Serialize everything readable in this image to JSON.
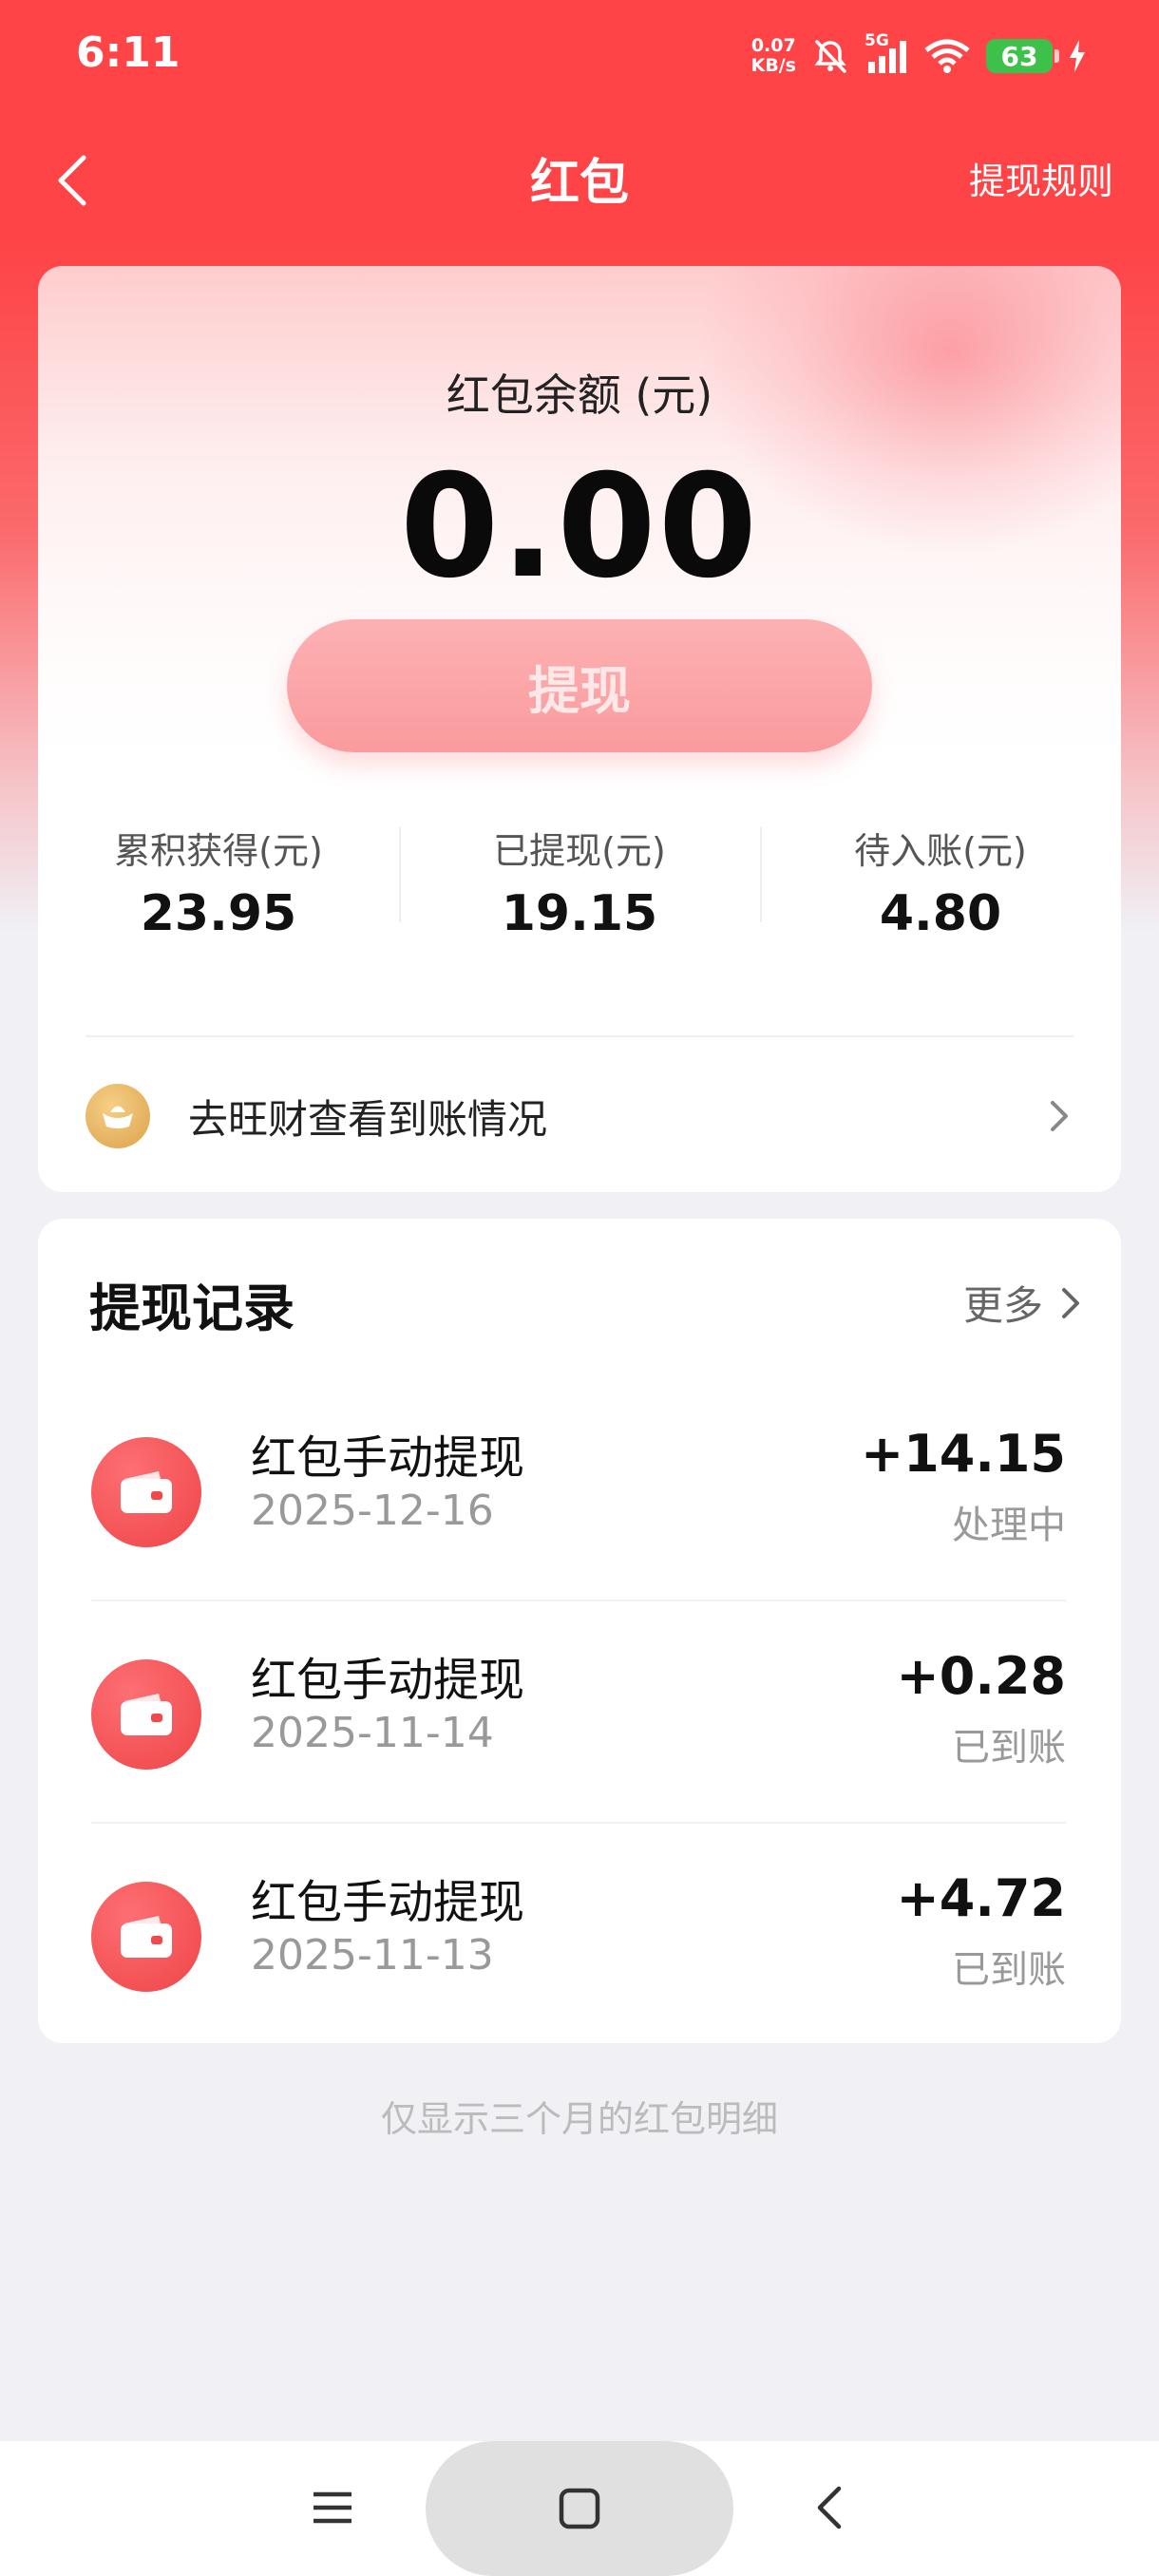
{
  "status_bar": {
    "time": "6:11",
    "net_speed_value": "0.07",
    "net_speed_unit": "KB/s",
    "network": "5G",
    "battery": "63"
  },
  "nav": {
    "title": "红包",
    "rules": "提现规则"
  },
  "balance": {
    "label": "红包余额 (元)",
    "amount": "0.00",
    "withdraw_label": "提现"
  },
  "stats": [
    {
      "label": "累积获得(元)",
      "value": "23.95"
    },
    {
      "label": "已提现(元)",
      "value": "19.15"
    },
    {
      "label": "待入账(元)",
      "value": "4.80"
    }
  ],
  "wangcai_link": "去旺财查看到账情况",
  "records": {
    "title": "提现记录",
    "more": "更多",
    "items": [
      {
        "title": "红包手动提现",
        "date": "2025-12-16",
        "amount": "+14.15",
        "status": "处理中"
      },
      {
        "title": "红包手动提现",
        "date": "2025-11-14",
        "amount": "+0.28",
        "status": "已到账"
      },
      {
        "title": "红包手动提现",
        "date": "2025-11-13",
        "amount": "+4.72",
        "status": "已到账"
      }
    ]
  },
  "footer_note": "仅显示三个月的红包明细",
  "colors": {
    "brand_red": "#fe4447",
    "button_pink": "#fa9b9d",
    "battery_green": "#3ec14a"
  }
}
